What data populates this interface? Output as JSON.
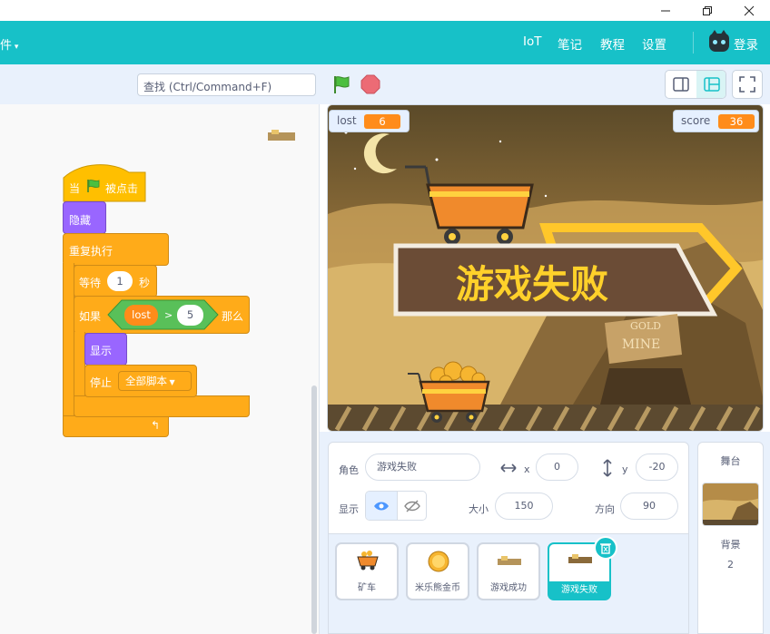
{
  "window": {
    "minimize_icon": "minimize-icon",
    "maximize_icon": "restore-icon",
    "close_icon": "close-icon"
  },
  "menubar": {
    "file_label": "件",
    "items": [
      "IoT",
      "笔记",
      "教程",
      "设置"
    ],
    "login_label": "登录",
    "accent": "#17c1c8"
  },
  "toolbar": {
    "search_placeholder": "查找 (Ctrl/Command+F)"
  },
  "script": {
    "when_label": "当",
    "clicked_label": "被点击",
    "hide_label": "隐藏",
    "forever_label": "重复执行",
    "wait_label": "等待",
    "wait_value": "1",
    "wait_unit": "秒",
    "if_label": "如果",
    "then_label": "那么",
    "cond_var": "lost",
    "cond_op": ">",
    "cond_value": "5",
    "show_label": "显示",
    "stop_label": "停止",
    "stop_option": "全部脚本"
  },
  "stage": {
    "monitors": [
      {
        "name": "lost",
        "value": "6"
      },
      {
        "name": "score",
        "value": "36"
      }
    ],
    "banner_text": "游戏失败",
    "sign_text_1": "GOLD",
    "sign_text_2": "MINE"
  },
  "sprite_info": {
    "sprite_label": "角色",
    "sprite_name": "游戏失败",
    "x_label": "x",
    "x_value": "0",
    "y_label": "y",
    "y_value": "-20",
    "show_label": "显示",
    "size_label": "大小",
    "size_value": "150",
    "direction_label": "方向",
    "direction_value": "90"
  },
  "sprites": [
    {
      "name": "矿车",
      "selected": false
    },
    {
      "name": "米乐熊金币",
      "selected": false
    },
    {
      "name": "游戏成功",
      "selected": false
    },
    {
      "name": "游戏失败",
      "selected": true
    }
  ],
  "stage_panel": {
    "title": "舞台",
    "backdrop_label": "背景",
    "backdrop_count": "2"
  }
}
